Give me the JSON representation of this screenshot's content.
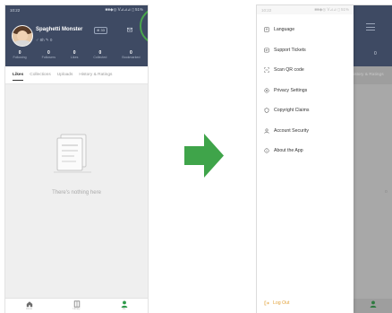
{
  "left_phone": {
    "status": {
      "time": "10:22",
      "icons": "■■◆◎ ᐯ⊿⊿⊿ ▯ 51%"
    },
    "profile": {
      "name": "Spaghetti Monster",
      "badge": "⊕ 33",
      "meta": "♂ 8h   ✎ 0"
    },
    "stats": [
      {
        "num": "0",
        "label": "Following"
      },
      {
        "num": "0",
        "label": "Followers"
      },
      {
        "num": "0",
        "label": "Likes"
      },
      {
        "num": "0",
        "label": "Collected"
      },
      {
        "num": "0",
        "label": "Bookmarked"
      }
    ],
    "tabs": [
      "Likes",
      "Collections",
      "Uploads",
      "History & Ratings"
    ],
    "active_tab": "Likes",
    "empty_text": "There's nothing here",
    "nav": [
      {
        "icon": "home-icon",
        "label": "Home"
      },
      {
        "icon": "library-icon",
        "label": "Library"
      },
      {
        "icon": "user-icon",
        "label": "Me"
      }
    ]
  },
  "right_phone": {
    "status": {
      "time": "10:22",
      "icons": "■■◆◎ ᐯ⊿⊿ ▯ 51%"
    },
    "menu_items": [
      {
        "icon": "language-icon",
        "label": "Language"
      },
      {
        "icon": "ticket-icon",
        "label": "Support Tickets"
      },
      {
        "icon": "qr-icon",
        "label": "Scan QR code"
      },
      {
        "icon": "privacy-icon",
        "label": "Privacy Settings"
      },
      {
        "icon": "copyright-icon",
        "label": "Copyright Claims"
      },
      {
        "icon": "account-icon",
        "label": "Account Security"
      },
      {
        "icon": "info-icon",
        "label": "About the App"
      }
    ],
    "logout_label": "Log Out",
    "background_tab_text": "istory & Ratings",
    "background_stat": "0"
  },
  "colors": {
    "header": "#3e4a63",
    "highlight_ring": "#4aa64c",
    "arrow": "#3fa44a",
    "active_nav": "#2e9a4a",
    "logout": "#e2a23a"
  }
}
